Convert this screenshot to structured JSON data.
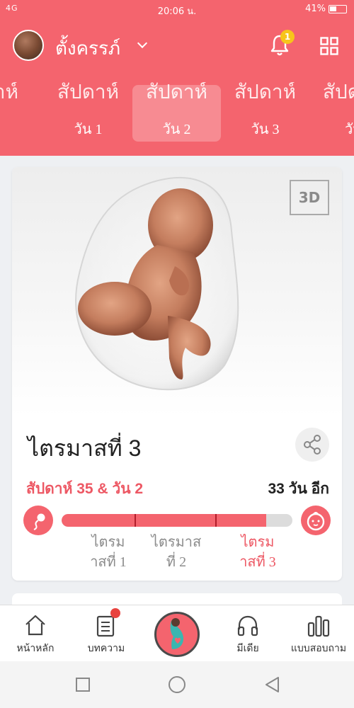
{
  "status_bar": {
    "signal_text": "4G",
    "time": "20:06 น.",
    "battery": "41%"
  },
  "header": {
    "username": "ตั้งครรภ์",
    "notification_count": "1"
  },
  "days": [
    {
      "top": "สัปดาห์",
      "label": "วัน 1"
    },
    {
      "top": "สัปดาห์",
      "label": "วัน 2"
    },
    {
      "top": "สัปดาห์",
      "label": "วัน 3"
    },
    {
      "top": "สัปดาห์",
      "label": "วัน"
    }
  ],
  "card": {
    "badge_3d": "3D",
    "title": "ไตรมาสที่ 3",
    "week_day": "สัปดาห์ 35 & วัน 2",
    "remaining": "33 วัน อีก",
    "progress_fraction": 0.885,
    "trimesters": [
      {
        "label": "ไตรม\nาสที่ 1"
      },
      {
        "label": "ไตรมาส\nที่ 2"
      },
      {
        "label": "ไตรม\nาสที่ 3"
      }
    ]
  },
  "nav": {
    "home": "หน้าหลัก",
    "articles": "บทความ",
    "media": "มีเดีย",
    "survey": "แบบสอบถาม"
  },
  "colors": {
    "brand": "#f4646e",
    "accent_text": "#ed5864",
    "badge": "#f7c51b"
  }
}
